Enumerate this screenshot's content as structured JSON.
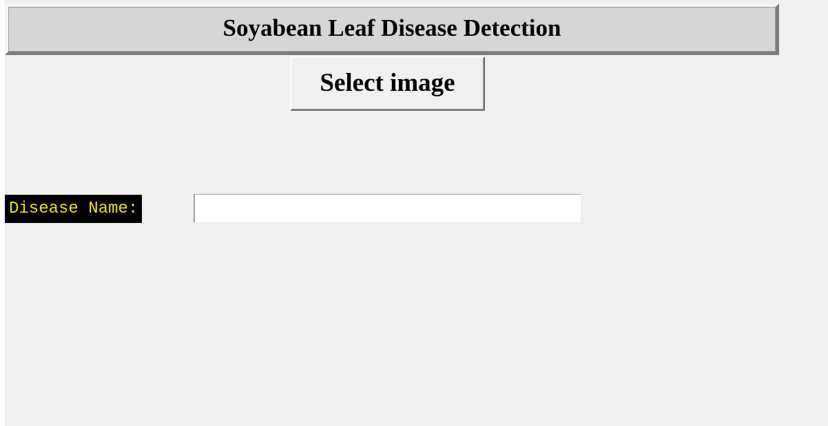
{
  "header": {
    "title": "Soyabean Leaf Disease Detection"
  },
  "controls": {
    "select_image_label": "Select image"
  },
  "result": {
    "label": "Disease Name:",
    "value": ""
  },
  "colors": {
    "window_bg": "#f0f0f0",
    "title_bg": "#d6d6d6",
    "label_bg": "#000000",
    "label_fg": "#e5e51e",
    "entry_bg": "#ffffff"
  }
}
